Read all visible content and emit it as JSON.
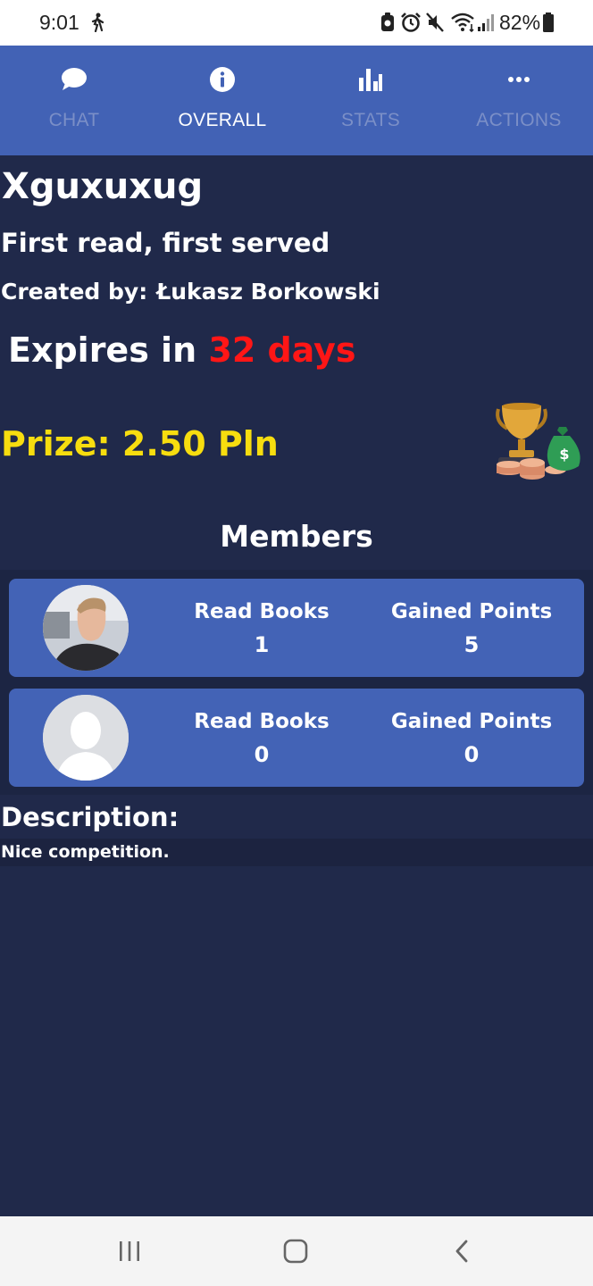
{
  "status_bar": {
    "time": "9:01",
    "battery": "82%",
    "icons": [
      "walk-icon",
      "notification-icon",
      "alarm-icon",
      "mute-icon",
      "wifi-icon",
      "signal-icon",
      "battery-icon"
    ]
  },
  "tabs": [
    {
      "label": "CHAT",
      "icon": "chat-bubble-icon",
      "active": false
    },
    {
      "label": "OVERALL",
      "icon": "info-icon",
      "active": true
    },
    {
      "label": "STATS",
      "icon": "bar-chart-icon",
      "active": false
    },
    {
      "label": "ACTIONS",
      "icon": "more-dots-icon",
      "active": false
    }
  ],
  "competition": {
    "title": "Xguxuxug",
    "subtitle": "First read, first served",
    "created_label": "Created by:",
    "creator": "Łukasz Borkowski",
    "expires_label": "Expires in",
    "expires_value": "32 days",
    "prize": "Prize: 2.50 Pln"
  },
  "members": {
    "heading": "Members",
    "items": [
      {
        "avatar": "user-photo",
        "read_books_label": "Read Books",
        "read_books": "1",
        "points_label": "Gained Points",
        "points": "5"
      },
      {
        "avatar": "default-avatar",
        "read_books_label": "Read Books",
        "read_books": "0",
        "points_label": "Gained Points",
        "points": "0"
      }
    ]
  },
  "description": {
    "heading": "Description:",
    "text": "Nice competition."
  },
  "colors": {
    "background": "#20294a",
    "tab_bar": "#4262b5",
    "card": "#4363b6",
    "expires_accent": "#ff1616",
    "prize": "#f7dd0f",
    "inactive_tab": "#7b8fc7"
  }
}
